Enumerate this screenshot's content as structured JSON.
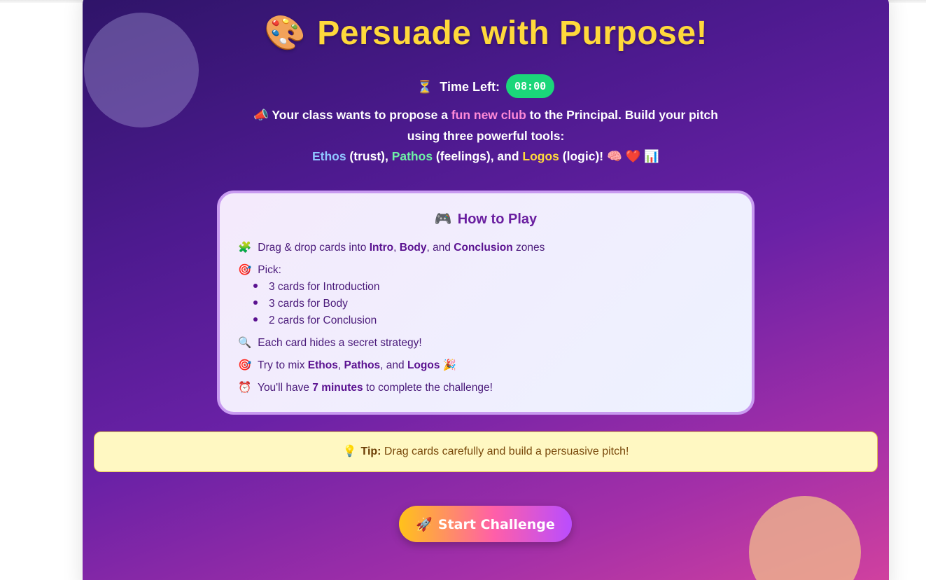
{
  "colors": {
    "title": "#ffd93b",
    "timer_badge": "#1bd67a",
    "tip_bg": "#fff8c2",
    "panel_border": "#c89af0",
    "ethos": "#8fc5ff",
    "pathos": "#6ef0a6",
    "logos": "#ffd93b",
    "highlight": "#ff8ad8"
  },
  "header": {
    "title_icon": "🎨",
    "title": "Persuade with Purpose!",
    "timer_icon": "⏳",
    "timer_label": "Time Left:",
    "timer_value": "08:00"
  },
  "intro": {
    "icon": "📣",
    "part1": " Your class wants to propose a ",
    "highlight": "fun new club",
    "part2": " to the Principal. Build your pitch using three powerful tools:",
    "ethos": "Ethos",
    "ethos_desc": " (trust), ",
    "pathos": "Pathos",
    "pathos_desc": " (feelings), and ",
    "logos": "Logos",
    "logos_desc": " (logic)! ",
    "trailing_icons": "🧠 ❤️ 📊"
  },
  "how_to_play": {
    "icon": "🎮",
    "title": "How to Play",
    "rule1": {
      "icon": "🧩",
      "pre": " Drag & drop cards into ",
      "intro": "Intro",
      "sep1": ", ",
      "body": "Body",
      "sep2": ", and ",
      "conclusion": "Conclusion",
      "post": " zones"
    },
    "rule2": {
      "icon": "🎯",
      "text": " Pick:",
      "items": [
        "3 cards for Introduction",
        "3 cards for Body",
        "2 cards for Conclusion"
      ]
    },
    "rule3": {
      "icon": "🔍",
      "text": " Each card hides a secret strategy!"
    },
    "rule4": {
      "icon": "🎯",
      "pre": " Try to mix ",
      "ethos": "Ethos",
      "sep1": ", ",
      "pathos": "Pathos",
      "sep2": ", and ",
      "logos": "Logos",
      "post": " 🎉"
    },
    "rule5": {
      "icon": "⏰",
      "pre": " You'll have ",
      "bold": "7 minutes",
      "post": " to complete the challenge!"
    }
  },
  "tip": {
    "icon": "💡",
    "label": "Tip:",
    "text": " Drag cards carefully and build a persuasive pitch!"
  },
  "start_button": {
    "icon": "🚀",
    "label": "Start Challenge"
  }
}
